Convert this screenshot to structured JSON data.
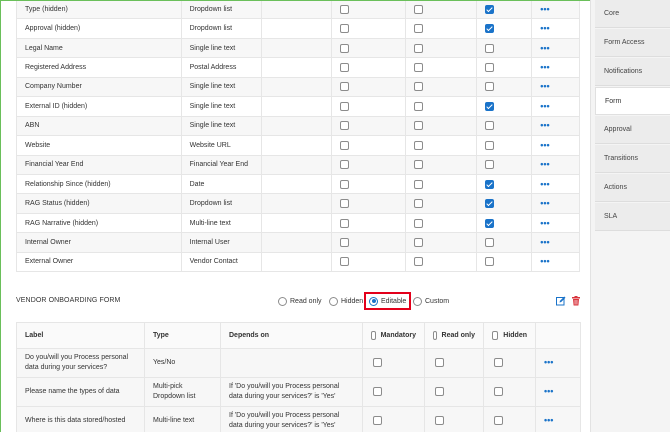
{
  "fields_table": {
    "rows": [
      {
        "label": "Type (hidden)",
        "type": "Dropdown list",
        "mandatory": false,
        "read_only": false,
        "hidden": true
      },
      {
        "label": "Approval (hidden)",
        "type": "Dropdown list",
        "mandatory": false,
        "read_only": false,
        "hidden": true
      },
      {
        "label": "Legal Name",
        "type": "Single line text",
        "mandatory": false,
        "read_only": false,
        "hidden": false
      },
      {
        "label": "Registered Address",
        "type": "Postal Address",
        "mandatory": false,
        "read_only": false,
        "hidden": false
      },
      {
        "label": "Company Number",
        "type": "Single line text",
        "mandatory": false,
        "read_only": false,
        "hidden": false
      },
      {
        "label": "External ID (hidden)",
        "type": "Single line text",
        "mandatory": false,
        "read_only": false,
        "hidden": true
      },
      {
        "label": "ABN",
        "type": "Single line text",
        "mandatory": false,
        "read_only": false,
        "hidden": false
      },
      {
        "label": "Website",
        "type": "Website URL",
        "mandatory": false,
        "read_only": false,
        "hidden": false
      },
      {
        "label": "Financial Year End",
        "type": "Financial Year End",
        "mandatory": false,
        "read_only": false,
        "hidden": false
      },
      {
        "label": "Relationship Since (hidden)",
        "type": "Date",
        "mandatory": false,
        "read_only": false,
        "hidden": true
      },
      {
        "label": "RAG Status (hidden)",
        "type": "Dropdown list",
        "mandatory": false,
        "read_only": false,
        "hidden": true
      },
      {
        "label": "RAG Narrative (hidden)",
        "type": "Multi-line text",
        "mandatory": false,
        "read_only": false,
        "hidden": true
      },
      {
        "label": "Internal Owner",
        "type": "Internal User",
        "mandatory": false,
        "read_only": false,
        "hidden": false
      },
      {
        "label": "External Owner",
        "type": "Vendor Contact",
        "mandatory": false,
        "read_only": false,
        "hidden": false
      }
    ],
    "more_label": "•••"
  },
  "section": {
    "title": "VENDOR ONBOARDING FORM",
    "options": [
      {
        "label": "Read only",
        "selected": false
      },
      {
        "label": "Hidden",
        "selected": false
      },
      {
        "label": "Editable",
        "selected": true
      },
      {
        "label": "Custom",
        "selected": false
      }
    ],
    "icons": [
      "edit-icon",
      "trash-icon"
    ],
    "colors": {
      "edit": "#1a73c9",
      "delete": "#d9363e",
      "highlight": "#e3001b"
    }
  },
  "vendor_table": {
    "headers": {
      "label": "Label",
      "type": "Type",
      "depends_on": "Depends on",
      "mandatory": "Mandatory",
      "read_only": "Read only",
      "hidden": "Hidden"
    },
    "rows": [
      {
        "label": "Do you/will you Process personal data during your services?",
        "type": "Yes/No",
        "depends_on": "",
        "mandatory": false,
        "read_only": false,
        "hidden": false
      },
      {
        "label": "Please name the types of data",
        "type": "Multi-pick Dropdown list",
        "depends_on": "If 'Do you/will you Process personal data during your services?' is 'Yes'",
        "mandatory": false,
        "read_only": false,
        "hidden": false
      },
      {
        "label": "Where is this data stored/hosted",
        "type": "Multi-line text",
        "depends_on": "If 'Do you/will you Process personal data during your services?' is 'Yes'",
        "mandatory": false,
        "read_only": false,
        "hidden": false
      }
    ],
    "more_label": "•••"
  },
  "sidebar": {
    "items": [
      {
        "label": "Core",
        "active": false
      },
      {
        "label": "Form Access",
        "active": false
      },
      {
        "label": "Notifications",
        "active": false
      },
      {
        "label": "Form",
        "active": true
      },
      {
        "label": "Approval",
        "active": false
      },
      {
        "label": "Transitions",
        "active": false
      },
      {
        "label": "Actions",
        "active": false
      },
      {
        "label": "SLA",
        "active": false
      }
    ]
  },
  "colors": {
    "accent": "#1a73c9",
    "frame": "#6abf5a"
  }
}
